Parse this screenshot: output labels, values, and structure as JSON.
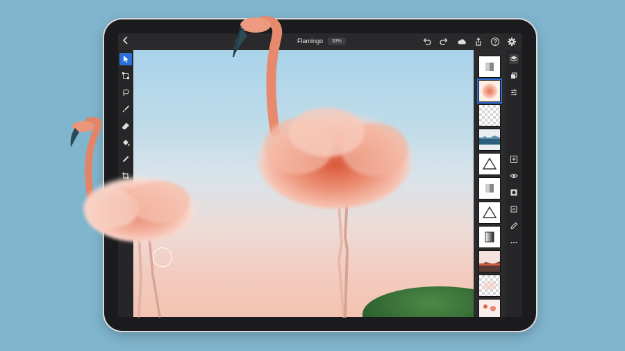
{
  "document": {
    "title": "Flamingo",
    "zoom": "33%"
  },
  "topbar_icons": [
    "back-chevron-icon",
    "undo-icon",
    "redo-icon",
    "cloud-icon",
    "share-icon",
    "help-icon",
    "settings-gear-icon"
  ],
  "tools": [
    "select-arrow-icon",
    "transform-icon",
    "lasso-icon",
    "brush-icon",
    "eraser-icon",
    "fill-bucket-icon",
    "eyedropper-icon",
    "crop-icon"
  ],
  "layers": [
    {
      "kind": "adjustment-gradient",
      "selected": false
    },
    {
      "kind": "flamingo-cloud",
      "selected": true
    },
    {
      "kind": "transparent",
      "selected": false
    },
    {
      "kind": "landscape-photo",
      "selected": false
    },
    {
      "kind": "triangle-shape",
      "selected": false
    },
    {
      "kind": "adjustment-gradient",
      "selected": false
    },
    {
      "kind": "triangle-shape",
      "selected": false
    },
    {
      "kind": "adjustment-levels",
      "selected": false
    },
    {
      "kind": "sunset-photo",
      "selected": false
    },
    {
      "kind": "transparent",
      "selected": false
    },
    {
      "kind": "flamingo-small",
      "selected": false
    }
  ],
  "property_icons": [
    "layers-icon",
    "layer-properties-icon",
    "adjustments-icon",
    "add-layer-icon",
    "visibility-eye-icon",
    "mask-icon",
    "crop-layer-icon",
    "edit-layer-icon",
    "more-options-icon"
  ],
  "colors": {
    "background": "#7fb5cd",
    "accent": "#2d6fd8",
    "flamingo": "#e88a72"
  }
}
